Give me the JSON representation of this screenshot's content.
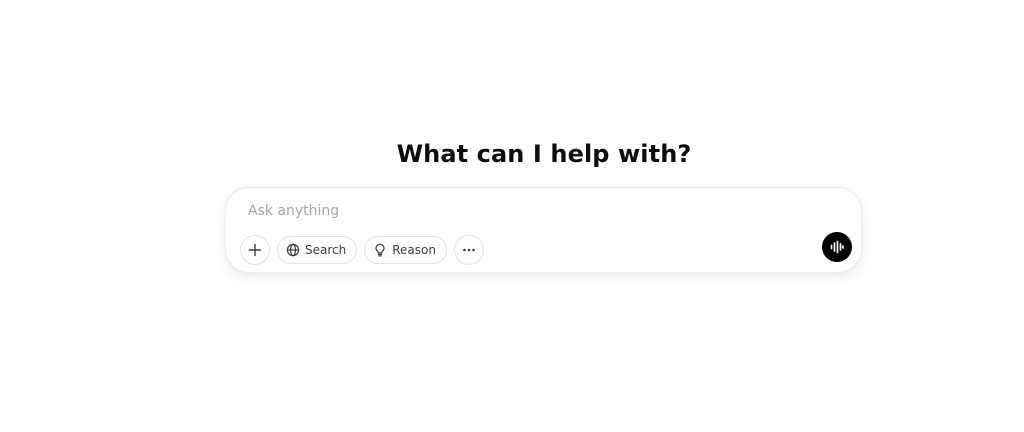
{
  "heading": {
    "title": "What can I help with?"
  },
  "composer": {
    "placeholder": "Ask anything",
    "value": "",
    "tools": {
      "attach_icon": "plus-icon",
      "search_label": "Search",
      "search_icon": "globe-icon",
      "reason_label": "Reason",
      "reason_icon": "lightbulb-icon",
      "more_icon": "ellipsis-icon"
    },
    "voice_icon": "waveform-icon"
  },
  "colors": {
    "background": "#ffffff",
    "text": "#0d0d0d",
    "placeholder": "#a6a6a6",
    "border": "#e3e3e3",
    "voice_button": "#000000"
  }
}
